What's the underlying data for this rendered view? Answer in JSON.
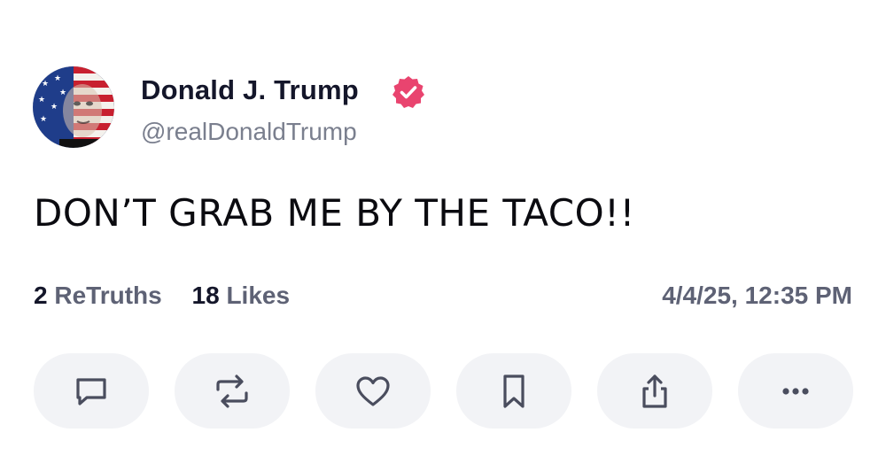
{
  "author": {
    "display_name": "Donald J. Trump",
    "handle": "@realDonaldTrump",
    "verified_badge_icon": "verified-badge-icon",
    "verified_color": "#e9446f",
    "avatar_icon": "flag-portrait-avatar"
  },
  "post": {
    "text": "DON’T GRAB ME BY THE TACO!!"
  },
  "stats": {
    "retruths_count": "2",
    "retruths_label": "ReTruths",
    "likes_count": "18",
    "likes_label": "Likes",
    "timestamp": "4/4/25, 12:35 PM"
  },
  "actions": [
    {
      "name": "reply",
      "icon": "comment-icon"
    },
    {
      "name": "retruth",
      "icon": "repost-icon"
    },
    {
      "name": "like",
      "icon": "heart-icon"
    },
    {
      "name": "bookmark",
      "icon": "bookmark-icon"
    },
    {
      "name": "share",
      "icon": "share-icon"
    },
    {
      "name": "more",
      "icon": "more-icon"
    }
  ],
  "colors": {
    "text_primary": "#14162a",
    "text_secondary": "#5e6275",
    "button_bg": "#f2f3f6",
    "icon_stroke": "#4a4d5e"
  }
}
